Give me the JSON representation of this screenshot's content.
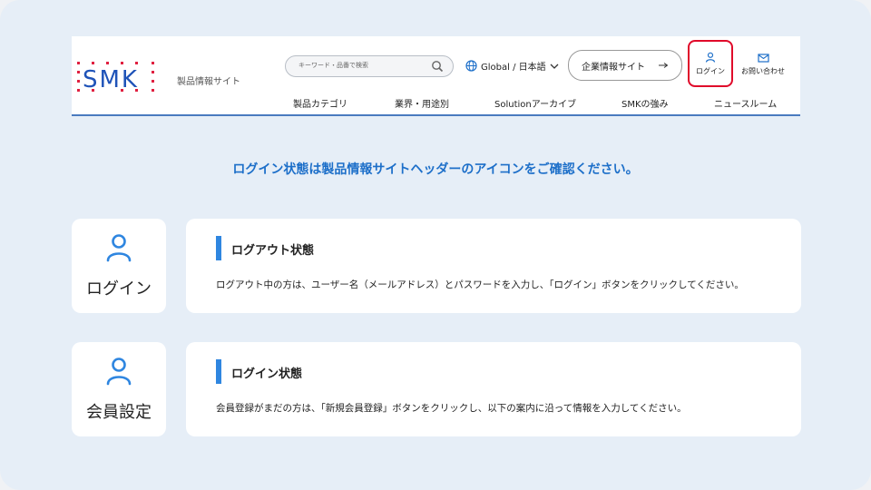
{
  "header": {
    "site_subtitle": "製品情報サイト",
    "search_placeholder": "キーワード・品番で検索",
    "language_label": "Global / 日本語",
    "corporate_button": "企業情報サイト",
    "login_label": "ログイン",
    "contact_label": "お問い合わせ",
    "nav": [
      "製品カテゴリ",
      "業界・用途別",
      "Solutionアーカイブ",
      "SMKの強み",
      "ニュースルーム"
    ]
  },
  "logo_text": "SMK",
  "headline": "ログイン状態は製品情報サイトヘッダーのアイコンをご確認ください。",
  "cards": [
    {
      "icon_label": "ログイン",
      "title": "ログアウト状態",
      "description": "ログアウト中の方は、ユーザー名（メールアドレス）とパスワードを入力し、「ログイン」ボタンをクリックしてください。"
    },
    {
      "icon_label": "会員設定",
      "title": "ログイン状態",
      "description": "会員登録がまだの方は、「新規会員登録」ボタンをクリックし、以下の案内に沿って情報を入力してください。"
    }
  ],
  "colors": {
    "accent_blue": "#1d6fc9",
    "highlight_red": "#e00a2a",
    "background": "#e6eef7"
  }
}
